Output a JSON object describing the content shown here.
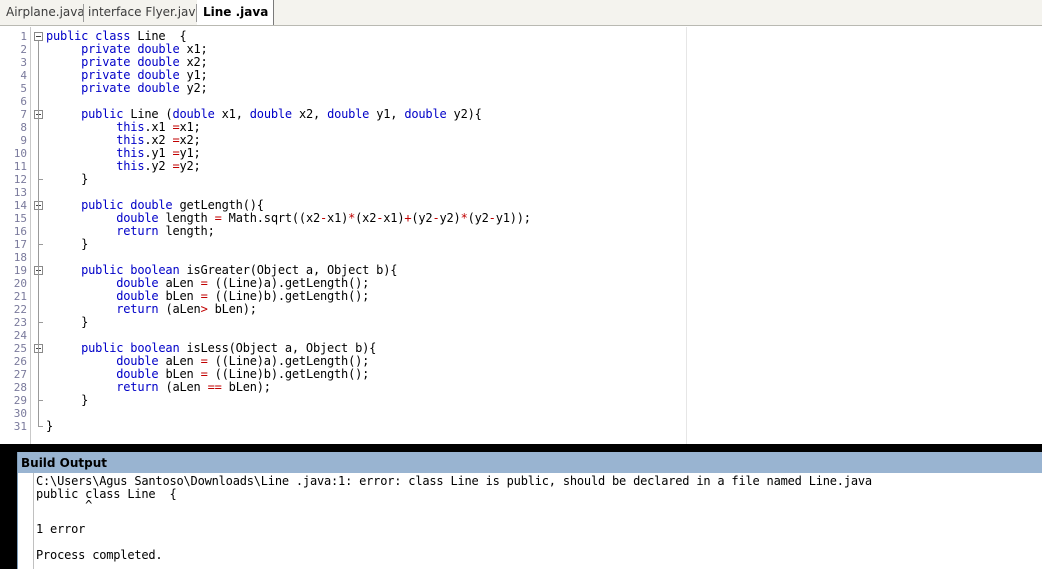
{
  "tabs": [
    {
      "label": "Airplane.java",
      "active": false
    },
    {
      "label": "interface Flyer.java",
      "active": false
    },
    {
      "label": "Line .java",
      "active": true
    }
  ],
  "editor": {
    "lines": [
      [
        [
          "kw",
          "public class "
        ],
        [
          "t",
          "Line  {"
        ]
      ],
      [
        [
          "t",
          "     "
        ],
        [
          "kw",
          "private double "
        ],
        [
          "t",
          "x1;"
        ]
      ],
      [
        [
          "t",
          "     "
        ],
        [
          "kw",
          "private double "
        ],
        [
          "t",
          "x2;"
        ]
      ],
      [
        [
          "t",
          "     "
        ],
        [
          "kw",
          "private double "
        ],
        [
          "t",
          "y1;"
        ]
      ],
      [
        [
          "t",
          "     "
        ],
        [
          "kw",
          "private double "
        ],
        [
          "t",
          "y2;"
        ]
      ],
      [],
      [
        [
          "t",
          "     "
        ],
        [
          "kw",
          "public "
        ],
        [
          "t",
          "Line ("
        ],
        [
          "kw",
          "double "
        ],
        [
          "t",
          "x1, "
        ],
        [
          "kw",
          "double "
        ],
        [
          "t",
          "x2, "
        ],
        [
          "kw",
          "double "
        ],
        [
          "t",
          "y1, "
        ],
        [
          "kw",
          "double "
        ],
        [
          "t",
          "y2){"
        ]
      ],
      [
        [
          "t",
          "          "
        ],
        [
          "kw",
          "this"
        ],
        [
          "t",
          ".x1 "
        ],
        [
          "op",
          "="
        ],
        [
          "t",
          "x1;"
        ]
      ],
      [
        [
          "t",
          "          "
        ],
        [
          "kw",
          "this"
        ],
        [
          "t",
          ".x2 "
        ],
        [
          "op",
          "="
        ],
        [
          "t",
          "x2;"
        ]
      ],
      [
        [
          "t",
          "          "
        ],
        [
          "kw",
          "this"
        ],
        [
          "t",
          ".y1 "
        ],
        [
          "op",
          "="
        ],
        [
          "t",
          "y1;"
        ]
      ],
      [
        [
          "t",
          "          "
        ],
        [
          "kw",
          "this"
        ],
        [
          "t",
          ".y2 "
        ],
        [
          "op",
          "="
        ],
        [
          "t",
          "y2;"
        ]
      ],
      [
        [
          "t",
          "     }"
        ]
      ],
      [],
      [
        [
          "t",
          "     "
        ],
        [
          "kw",
          "public double "
        ],
        [
          "t",
          "getLength(){"
        ]
      ],
      [
        [
          "t",
          "          "
        ],
        [
          "kw",
          "double "
        ],
        [
          "t",
          "length "
        ],
        [
          "op",
          "="
        ],
        [
          "t",
          " Math.sqrt((x2"
        ],
        [
          "op",
          "-"
        ],
        [
          "t",
          "x1)"
        ],
        [
          "op",
          "*"
        ],
        [
          "t",
          "(x2"
        ],
        [
          "op",
          "-"
        ],
        [
          "t",
          "x1)"
        ],
        [
          "op",
          "+"
        ],
        [
          "t",
          "(y2"
        ],
        [
          "op",
          "-"
        ],
        [
          "t",
          "y2)"
        ],
        [
          "op",
          "*"
        ],
        [
          "t",
          "(y2"
        ],
        [
          "op",
          "-"
        ],
        [
          "t",
          "y1));"
        ]
      ],
      [
        [
          "t",
          "          "
        ],
        [
          "kw",
          "return "
        ],
        [
          "t",
          "length;"
        ]
      ],
      [
        [
          "t",
          "     }"
        ]
      ],
      [],
      [
        [
          "t",
          "     "
        ],
        [
          "kw",
          "public boolean "
        ],
        [
          "t",
          "isGreater(Object a, Object b){"
        ]
      ],
      [
        [
          "t",
          "          "
        ],
        [
          "kw",
          "double "
        ],
        [
          "t",
          "aLen "
        ],
        [
          "op",
          "="
        ],
        [
          "t",
          " ((Line)a).getLength();"
        ]
      ],
      [
        [
          "t",
          "          "
        ],
        [
          "kw",
          "double "
        ],
        [
          "t",
          "bLen "
        ],
        [
          "op",
          "="
        ],
        [
          "t",
          " ((Line)b).getLength();"
        ]
      ],
      [
        [
          "t",
          "          "
        ],
        [
          "kw",
          "return "
        ],
        [
          "t",
          "(aLen"
        ],
        [
          "op",
          ">"
        ],
        [
          "t",
          " bLen);"
        ]
      ],
      [
        [
          "t",
          "     }"
        ]
      ],
      [],
      [
        [
          "t",
          "     "
        ],
        [
          "kw",
          "public boolean "
        ],
        [
          "t",
          "isLess(Object a, Object b){"
        ]
      ],
      [
        [
          "t",
          "          "
        ],
        [
          "kw",
          "double "
        ],
        [
          "t",
          "aLen "
        ],
        [
          "op",
          "="
        ],
        [
          "t",
          " ((Line)a).getLength();"
        ]
      ],
      [
        [
          "t",
          "          "
        ],
        [
          "kw",
          "double "
        ],
        [
          "t",
          "bLen "
        ],
        [
          "op",
          "="
        ],
        [
          "t",
          " ((Line)b).getLength();"
        ]
      ],
      [
        [
          "t",
          "          "
        ],
        [
          "kw",
          "return "
        ],
        [
          "t",
          "(aLen "
        ],
        [
          "op",
          "=="
        ],
        [
          "t",
          " bLen);"
        ]
      ],
      [
        [
          "t",
          "     }"
        ]
      ],
      [],
      [
        [
          "t",
          "}"
        ]
      ]
    ]
  },
  "build_output": {
    "title": "Build Output",
    "lines": [
      "C:\\Users\\Agus Santoso\\Downloads\\Line .java:1: error: class Line is public, should be declared in a file named Line.java",
      "public class Line  {",
      "       ^",
      "1 error",
      "",
      "Process completed."
    ]
  },
  "colors": {
    "keyword": "#0000c8",
    "operator": "#c00000",
    "line_number": "#7a7a9c",
    "output_title_bg": "#99b4d1"
  }
}
